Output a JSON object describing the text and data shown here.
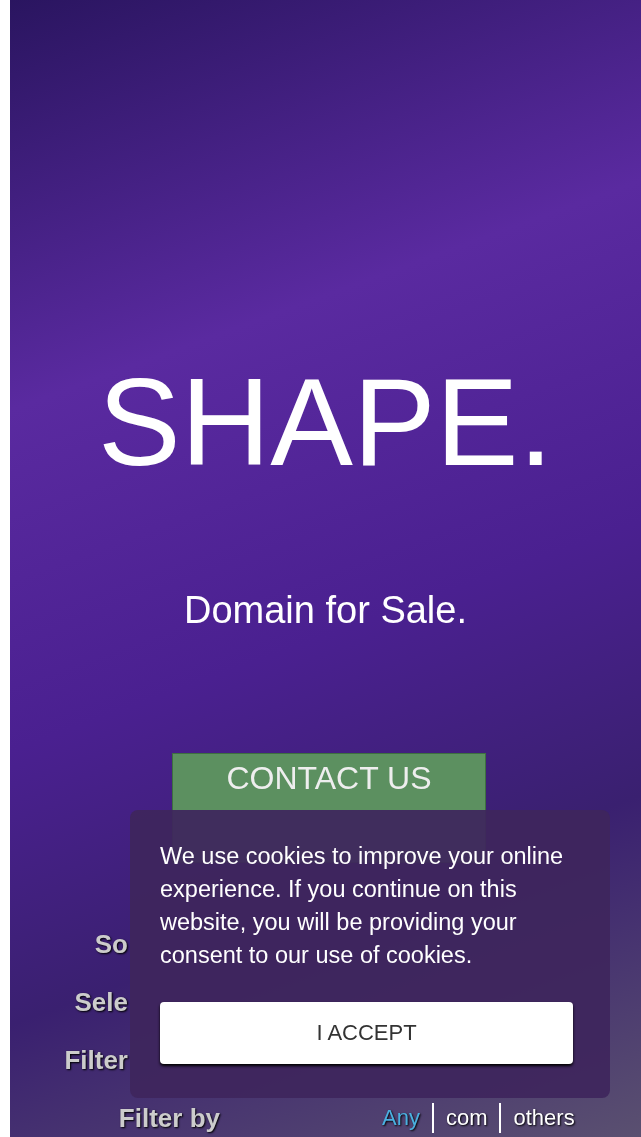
{
  "hero": {
    "title": "SHAPE.",
    "subtitle": "Domain for Sale.",
    "button": "CONTACT US"
  },
  "filters": [
    {
      "label": "So"
    },
    {
      "label": "Sele"
    },
    {
      "label": "Filter"
    },
    {
      "label": "Filter by",
      "options": [
        {
          "label": "Any",
          "selected": true
        },
        {
          "label": "com",
          "selected": false
        },
        {
          "label": "others",
          "selected": false
        }
      ]
    }
  ],
  "cookie_banner": {
    "message": "We use cookies to improve your online experience. If you continue on this website, you will be providing your consent to our use of cookies.",
    "button": "I ACCEPT"
  }
}
